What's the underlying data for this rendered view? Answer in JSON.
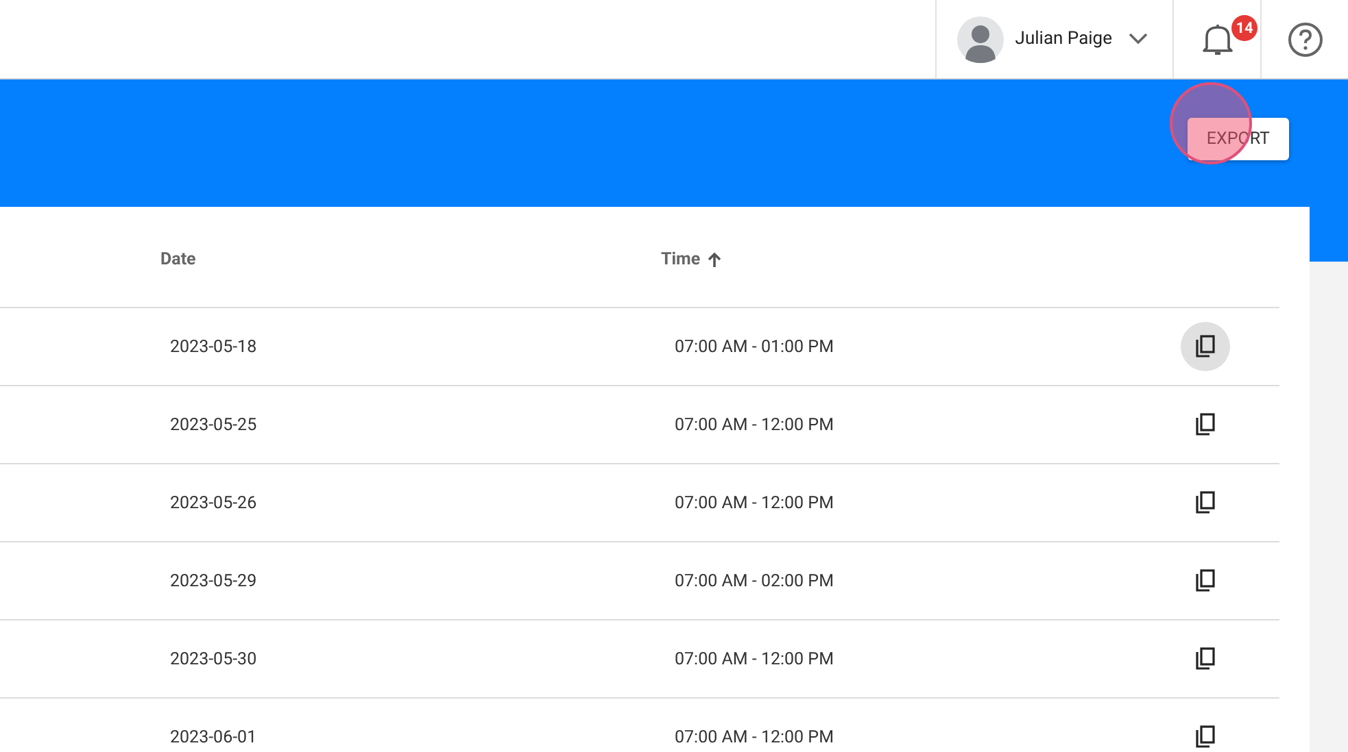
{
  "header": {
    "user_name": "Julian Paige",
    "notification_count": "14"
  },
  "toolbar": {
    "export_label": "EXPORT",
    "click_indicator": true
  },
  "table": {
    "columns": [
      {
        "label": "Date",
        "sorted": false
      },
      {
        "label": "Time",
        "sorted": true
      }
    ],
    "rows": [
      {
        "date": "2023-05-18",
        "time": "07:00 AM - 01:00 PM",
        "hovered": true
      },
      {
        "date": "2023-05-25",
        "time": "07:00 AM - 12:00 PM",
        "hovered": false
      },
      {
        "date": "2023-05-26",
        "time": "07:00 AM - 12:00 PM",
        "hovered": false
      },
      {
        "date": "2023-05-29",
        "time": "07:00 AM - 02:00 PM",
        "hovered": false
      },
      {
        "date": "2023-05-30",
        "time": "07:00 AM - 12:00 PM",
        "hovered": false
      },
      {
        "date": "2023-06-01",
        "time": "07:00 AM - 12:00 PM",
        "hovered": false
      }
    ]
  }
}
